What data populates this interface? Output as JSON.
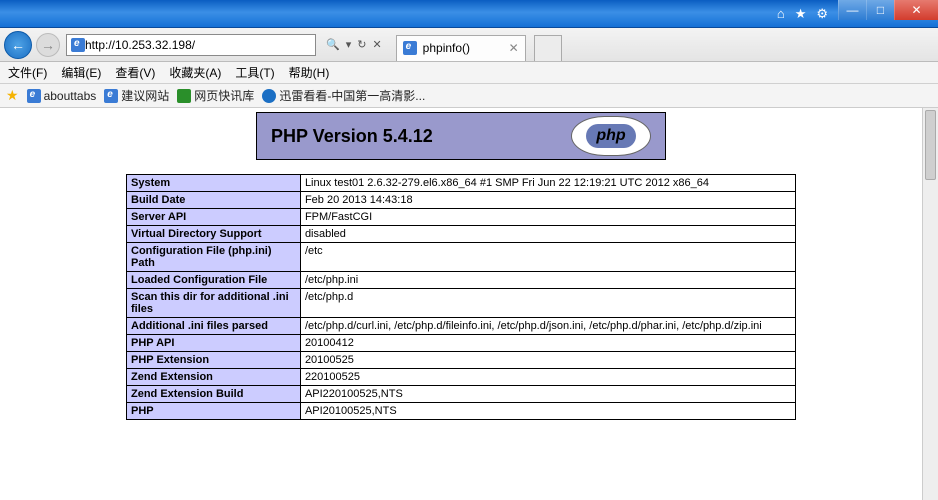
{
  "titlebar": {
    "min": "—",
    "max": "□",
    "close": "✕",
    "home": "⌂",
    "star": "★",
    "gear": "⚙"
  },
  "nav": {
    "back": "←",
    "fwd": "→",
    "url": "http://10.253.32.198/",
    "search_icon": "🔍",
    "refresh": "↻",
    "stop": "✕",
    "dropdown": "▾"
  },
  "tab": {
    "title": "phpinfo()",
    "close": "✕"
  },
  "menu": {
    "items": [
      "文件(F)",
      "编辑(E)",
      "查看(V)",
      "收藏夹(A)",
      "工具(T)",
      "帮助(H)"
    ]
  },
  "favs": {
    "items": [
      "abouttabs",
      "建议网站",
      "网页快讯库",
      "迅雷看看-中国第一高清影..."
    ]
  },
  "php": {
    "version_label": "PHP Version 5.4.12",
    "logo": "php",
    "rows": [
      {
        "k": "System",
        "v": "Linux test01 2.6.32-279.el6.x86_64 #1 SMP Fri Jun 22 12:19:21 UTC 2012 x86_64"
      },
      {
        "k": "Build Date",
        "v": "Feb 20 2013 14:43:18"
      },
      {
        "k": "Server API",
        "v": "FPM/FastCGI"
      },
      {
        "k": "Virtual Directory Support",
        "v": "disabled"
      },
      {
        "k": "Configuration File (php.ini) Path",
        "v": "/etc"
      },
      {
        "k": "Loaded Configuration File",
        "v": "/etc/php.ini"
      },
      {
        "k": "Scan this dir for additional .ini files",
        "v": "/etc/php.d"
      },
      {
        "k": "Additional .ini files parsed",
        "v": "/etc/php.d/curl.ini, /etc/php.d/fileinfo.ini, /etc/php.d/json.ini, /etc/php.d/phar.ini, /etc/php.d/zip.ini"
      },
      {
        "k": "PHP API",
        "v": "20100412"
      },
      {
        "k": "PHP Extension",
        "v": "20100525"
      },
      {
        "k": "Zend Extension",
        "v": "220100525"
      },
      {
        "k": "Zend Extension Build",
        "v": "API220100525,NTS"
      },
      {
        "k": "PHP",
        "v": "API20100525,NTS"
      }
    ]
  }
}
